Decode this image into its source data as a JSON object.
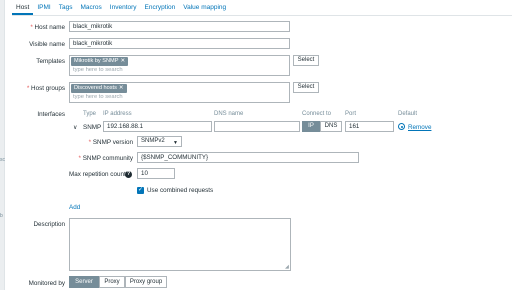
{
  "tabs": [
    {
      "label": "Host",
      "active": true
    },
    {
      "label": "IPMI",
      "active": false
    },
    {
      "label": "Tags",
      "active": false
    },
    {
      "label": "Macros",
      "active": false
    },
    {
      "label": "Inventory",
      "active": false
    },
    {
      "label": "Encryption",
      "active": false
    },
    {
      "label": "Value mapping",
      "active": false
    }
  ],
  "left_strip": {
    "text_a": "sc",
    "text_b": "b"
  },
  "form": {
    "host_name": {
      "label": "Host name",
      "value": "black_mikrotik"
    },
    "visible_name": {
      "label": "Visible name",
      "value": "black_mikrotik"
    },
    "templates": {
      "label": "Templates",
      "chip": "Mikrotik by SNMP",
      "placeholder": "type here to search",
      "select_label": "Select"
    },
    "host_groups": {
      "label": "Host groups",
      "chip": "Discovered hosts",
      "placeholder": "type here to search",
      "select_label": "Select"
    },
    "interfaces": {
      "label": "Interfaces",
      "headers": {
        "type": "Type",
        "ip": "IP address",
        "dns": "DNS name",
        "connect": "Connect to",
        "port": "Port",
        "default": "Default"
      },
      "row": {
        "type": "SNMP",
        "ip": "192.168.88.1",
        "dns": "",
        "connect_ip": "IP",
        "connect_dns": "DNS",
        "port": "161",
        "remove": "Remove"
      },
      "snmp_version": {
        "label": "SNMP version",
        "value": "SNMPv2"
      },
      "snmp_community": {
        "label": "SNMP community",
        "value": "{$SNMP_COMMUNITY}"
      },
      "max_repetition": {
        "label": "Max repetition count",
        "value": "10"
      },
      "combined_requests": {
        "label": "Use combined requests",
        "checked": true
      },
      "add_label": "Add"
    },
    "description": {
      "label": "Description",
      "value": ""
    },
    "monitored_by": {
      "label": "Monitored by",
      "options": [
        "Server",
        "Proxy",
        "Proxy group"
      ],
      "selected": "Server"
    }
  },
  "colors": {
    "accent": "#0275b8",
    "chip": "#768d99",
    "required": "#e45959"
  }
}
